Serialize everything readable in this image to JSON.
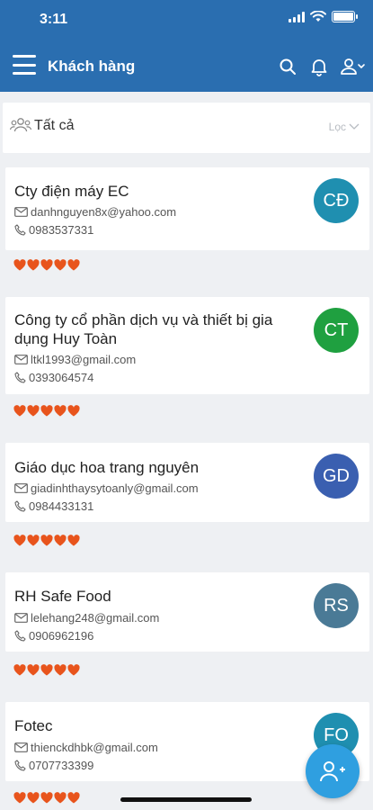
{
  "status_bar": {
    "time": "3:11"
  },
  "header": {
    "title": "Khách hàng",
    "accent": "#2a6eb0"
  },
  "filter": {
    "label": "Tất cả",
    "action": "Lọc"
  },
  "customers": [
    {
      "name": "Cty điện máy EC",
      "email": "danhnguyen8x@yahoo.com",
      "phone": "0983537331",
      "initials": "CĐ",
      "rating": 5
    },
    {
      "name": "Công ty cổ phần dịch vụ và thiết bị gia dụng Huy Toàn",
      "email": "ltkl1993@gmail.com",
      "phone": "0393064574",
      "initials": "CT",
      "rating": 5
    },
    {
      "name": "Giáo dục hoa trang nguyên",
      "email": "giadinhthaysytoanly@gmail.com",
      "phone": "0984433131",
      "initials": "GD",
      "rating": 5
    },
    {
      "name": "RH Safe Food",
      "email": "lelehang248@gmail.com",
      "phone": "0906962196",
      "initials": "RS",
      "rating": 5
    },
    {
      "name": "Fotec",
      "email": "thienckdhbk@gmail.com",
      "phone": "0707733399",
      "initials": "FO",
      "rating": 5
    }
  ],
  "icons": {
    "menu": "hamburger-icon",
    "search": "search-icon",
    "notification": "bell-icon",
    "account": "user-icon",
    "filter": "users-icon",
    "email": "envelope-icon",
    "phone": "phone-icon",
    "rating": "heart-icon",
    "add_customer": "add-user-icon"
  },
  "colors": {
    "rating": "#e8541c",
    "fab": "#2f9fe0",
    "avatars": [
      "#1f8fb0",
      "#1fa040",
      "#3a5fb0",
      "#4a7a96",
      "#1f8fb0"
    ]
  }
}
